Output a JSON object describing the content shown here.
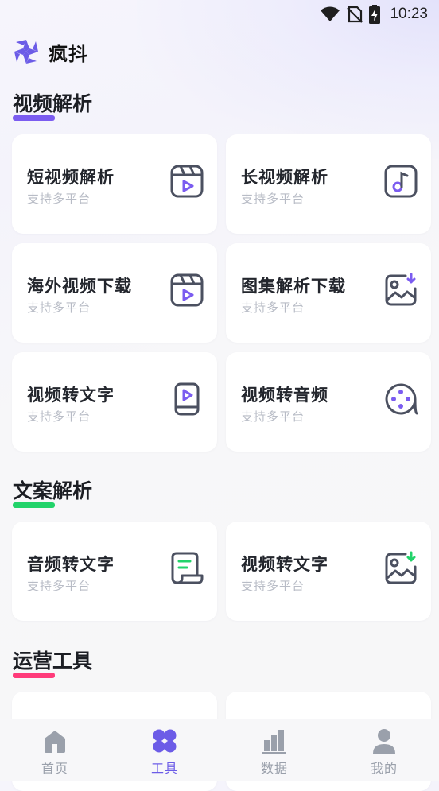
{
  "status_bar": {
    "time": "10:23",
    "icons": [
      "wifi-icon",
      "no-sim-icon",
      "battery-charging-icon"
    ]
  },
  "app": {
    "name": "疯抖",
    "logo_icon": "pinwheel-logo-icon",
    "accent": "#6c5ce7"
  },
  "sections": [
    {
      "title": "视频解析",
      "underline_color": "#7b5cf0",
      "cards": [
        {
          "title": "短视频解析",
          "subtitle": "支持多平台",
          "icon": "video-clapper-icon"
        },
        {
          "title": "长视频解析",
          "subtitle": "支持多平台",
          "icon": "music-note-icon"
        },
        {
          "title": "海外视频下载",
          "subtitle": "支持多平台",
          "icon": "video-clapper-icon"
        },
        {
          "title": "图集解析下载",
          "subtitle": "支持多平台",
          "icon": "image-download-icon"
        },
        {
          "title": "视频转文字",
          "subtitle": "支持多平台",
          "icon": "phone-play-icon"
        },
        {
          "title": "视频转音频",
          "subtitle": "支持多平台",
          "icon": "film-reel-icon"
        }
      ]
    },
    {
      "title": "文案解析",
      "underline_color": "#22d36a",
      "cards": [
        {
          "title": "音频转文字",
          "subtitle": "支持多平台",
          "icon": "scroll-text-icon"
        },
        {
          "title": "视频转文字",
          "subtitle": "支持多平台",
          "icon": "image-download-icon"
        }
      ]
    },
    {
      "title": "运营工具",
      "underline_color": "#ff3b7a",
      "cards": []
    }
  ],
  "bottom_nav": [
    {
      "label": "首页",
      "icon": "home-icon",
      "active": false
    },
    {
      "label": "工具",
      "icon": "tools-grid-icon",
      "active": true
    },
    {
      "label": "数据",
      "icon": "bar-chart-icon",
      "active": false
    },
    {
      "label": "我的",
      "icon": "user-icon",
      "active": false
    }
  ]
}
